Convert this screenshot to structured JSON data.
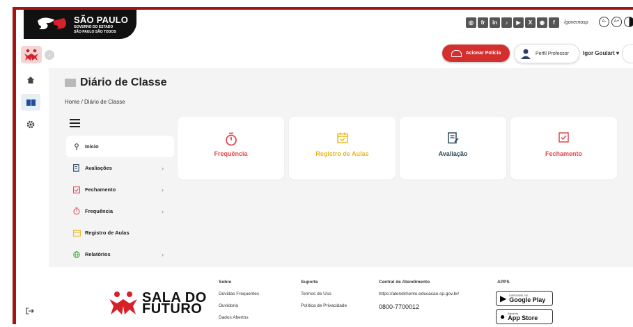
{
  "gov": {
    "title": "SÃO PAULO",
    "sub1": "GOVERNO DO ESTADO",
    "sub2": "SÃO PAULO SÃO TODOS",
    "social_icons": [
      "whatsapp-icon",
      "flickr-icon",
      "linkedin-icon",
      "tiktok-icon",
      "youtube-icon",
      "x-icon",
      "instagram-icon",
      "facebook-icon"
    ],
    "handle": "/governosp"
  },
  "header": {
    "police_label": "Acionar Polícia",
    "profile_label": "Perfil Professor",
    "user_name": "Igor Goulart ▾"
  },
  "page": {
    "title": "Diário de Classe",
    "breadcrumb": "Home  /  Diário de Classe"
  },
  "menu": [
    {
      "label": "Início",
      "icon": "pin-icon",
      "active": true
    },
    {
      "label": "Avaliações",
      "icon": "clipboard-icon",
      "chevron": true
    },
    {
      "label": "Fechamento",
      "icon": "check-box-icon",
      "chevron": true
    },
    {
      "label": "Frequência",
      "icon": "stopwatch-icon",
      "chevron": true
    },
    {
      "label": "Registro de Aulas",
      "icon": "calendar-icon"
    },
    {
      "label": "Relatórios",
      "icon": "globe-icon",
      "chevron": true
    }
  ],
  "cards": [
    {
      "label": "Frequência",
      "color": "#e0484f",
      "icon": "stopwatch-icon"
    },
    {
      "label": "Registro de Aulas",
      "color": "#e8b923",
      "icon": "calendar-check-icon"
    },
    {
      "label": "Avaliação",
      "color": "#2c4a5a",
      "icon": "document-edit-icon"
    },
    {
      "label": "Fechamento",
      "color": "#e0484f",
      "icon": "check-box-icon"
    }
  ],
  "footer": {
    "logo_line1": "SALA DO",
    "logo_line2": "FUTURO",
    "col1": [
      "Sobre",
      "Dúvidas Frequentes",
      "Ouvidoria",
      "Dados Abertos"
    ],
    "col2": [
      "Suporte",
      "Termos de Uso",
      "Política de Privacidade"
    ],
    "support_title": "Central de Atendimento",
    "support_url": "https://atendimento.educacao.sp.gov.br/",
    "phone": "0800-7700012",
    "apps_title": "APPS",
    "google_small": "DISPONÍVEL NO",
    "google_big": "Google Play",
    "apple_small": "Baixar na",
    "apple_big": "App Store"
  }
}
